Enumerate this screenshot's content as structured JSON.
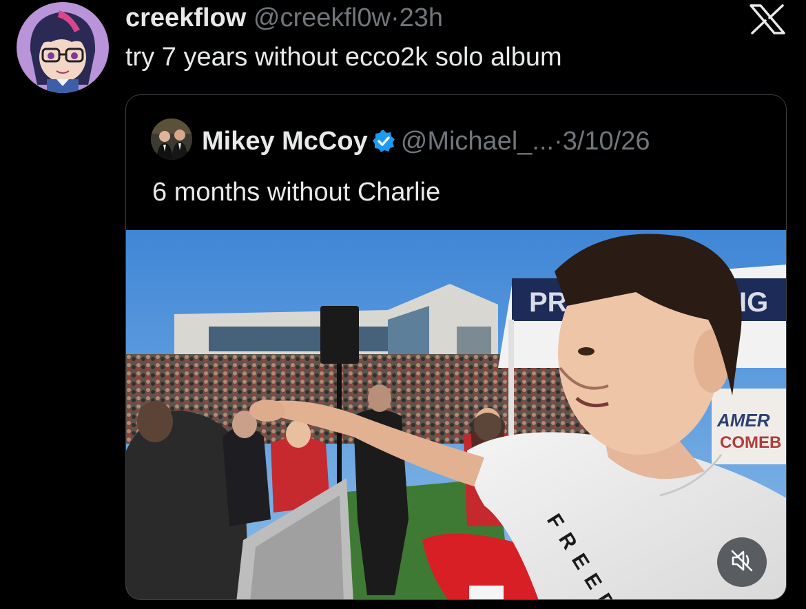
{
  "tweet": {
    "author_name": "creekflow",
    "handle": "@creekfl0w",
    "separator": "·",
    "time": "23h",
    "text": "try 7 years without ecco2k solo album"
  },
  "quoted_tweet": {
    "author_name": "Mikey McCoy",
    "verified": true,
    "handle": "@Michael_...",
    "separator": "·",
    "date": "3/10/26",
    "text": "6 months without Charlie"
  },
  "media": {
    "banner_left_text": "PR",
    "banner_right_text": "IG",
    "sign_text_1": "AMER",
    "sign_text_2": "COMEB",
    "shirt_text": "FREED",
    "mute_icon": "muted-speaker-icon"
  },
  "icons": {
    "logo": "x-logo-icon",
    "verified": "verified-badge-icon"
  },
  "colors": {
    "background": "#000000",
    "text_primary": "#e7e9ea",
    "text_secondary": "#71767b",
    "verified_blue": "#1d9bf0",
    "quote_border": "#3a3f44"
  }
}
